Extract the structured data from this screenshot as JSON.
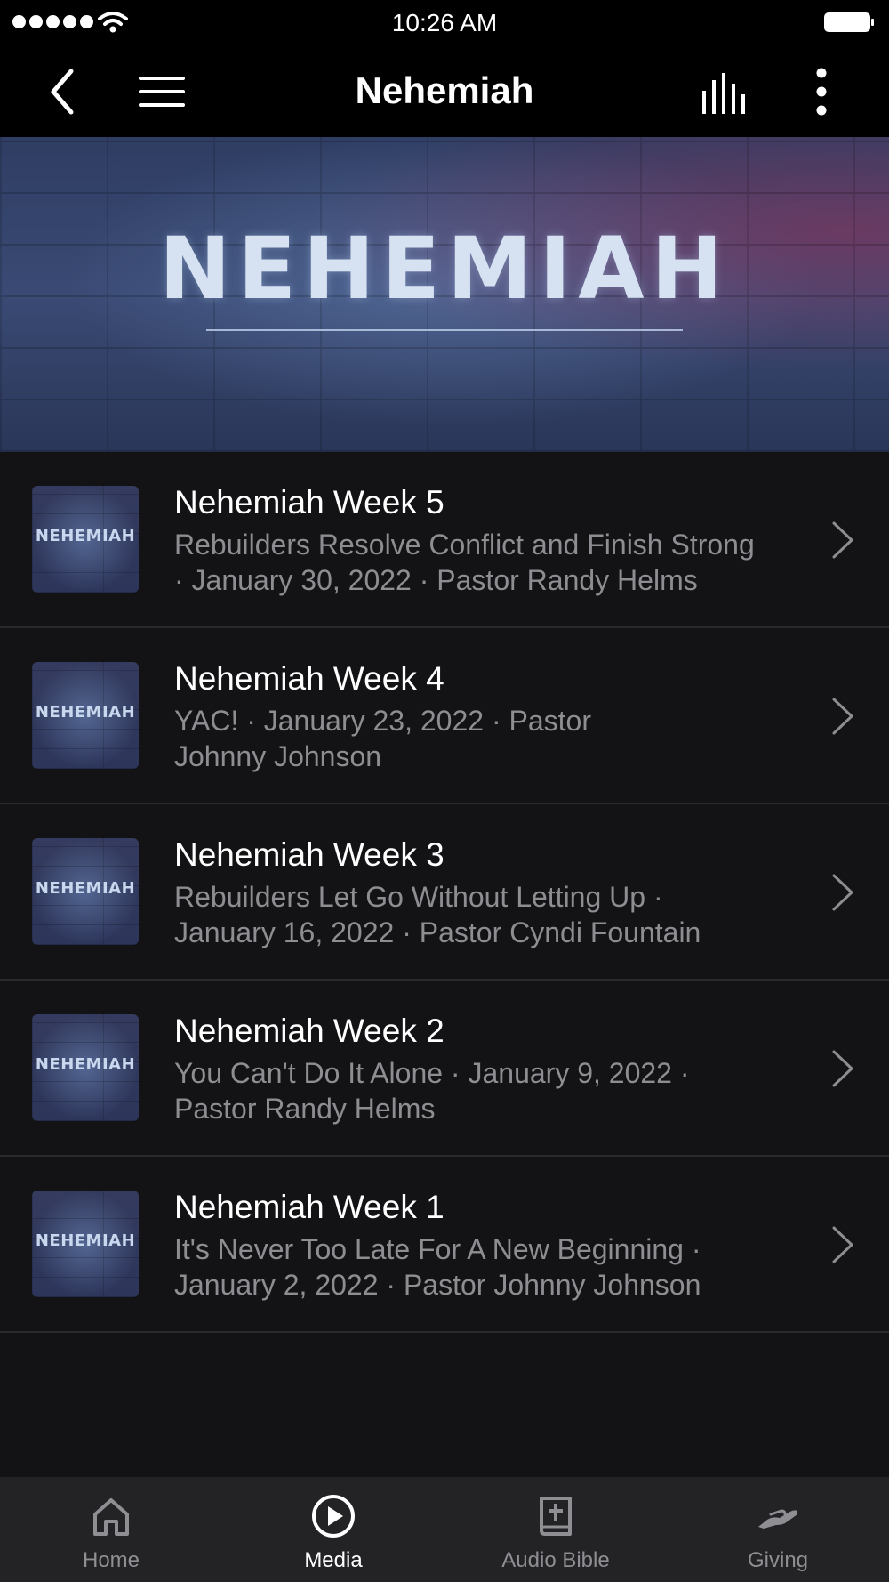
{
  "status_bar": {
    "time": "10:26 AM"
  },
  "header": {
    "title": "Nehemiah"
  },
  "banner": {
    "text": "NEHEMIAH"
  },
  "thumbnail_label": "NEHEMIAH",
  "episodes": [
    {
      "title": "Nehemiah Week 5",
      "line1": "Rebuilders Resolve Conflict and Finish Strong",
      "line2": "· January 30, 2022 · Pastor Randy Helms"
    },
    {
      "title": "Nehemiah Week 4",
      "line1": "YAC! · January 23, 2022 · Pastor",
      "line2": "Johnny Johnson"
    },
    {
      "title": "Nehemiah Week 3",
      "line1": "Rebuilders Let Go Without Letting Up ·",
      "line2": "January 16, 2022 · Pastor Cyndi Fountain"
    },
    {
      "title": "Nehemiah Week 2",
      "line1": "You Can't Do It Alone · January 9, 2022 ·",
      "line2": "Pastor Randy Helms"
    },
    {
      "title": "Nehemiah Week 1",
      "line1": "It's Never Too Late For A New Beginning ·",
      "line2": "January 2, 2022 · Pastor Johnny Johnson"
    }
  ],
  "tabs": [
    {
      "label": "Home",
      "icon": "home-icon",
      "active": false
    },
    {
      "label": "Media",
      "icon": "play-circle-icon",
      "active": true
    },
    {
      "label": "Audio Bible",
      "icon": "bible-icon",
      "active": false
    },
    {
      "label": "Giving",
      "icon": "giving-hand-icon",
      "active": false
    }
  ],
  "colors": {
    "background": "#131315",
    "header": "#000000",
    "tab_bar": "#232326",
    "subtitle": "#8d8d92",
    "tab_inactive": "#8e8e93"
  }
}
